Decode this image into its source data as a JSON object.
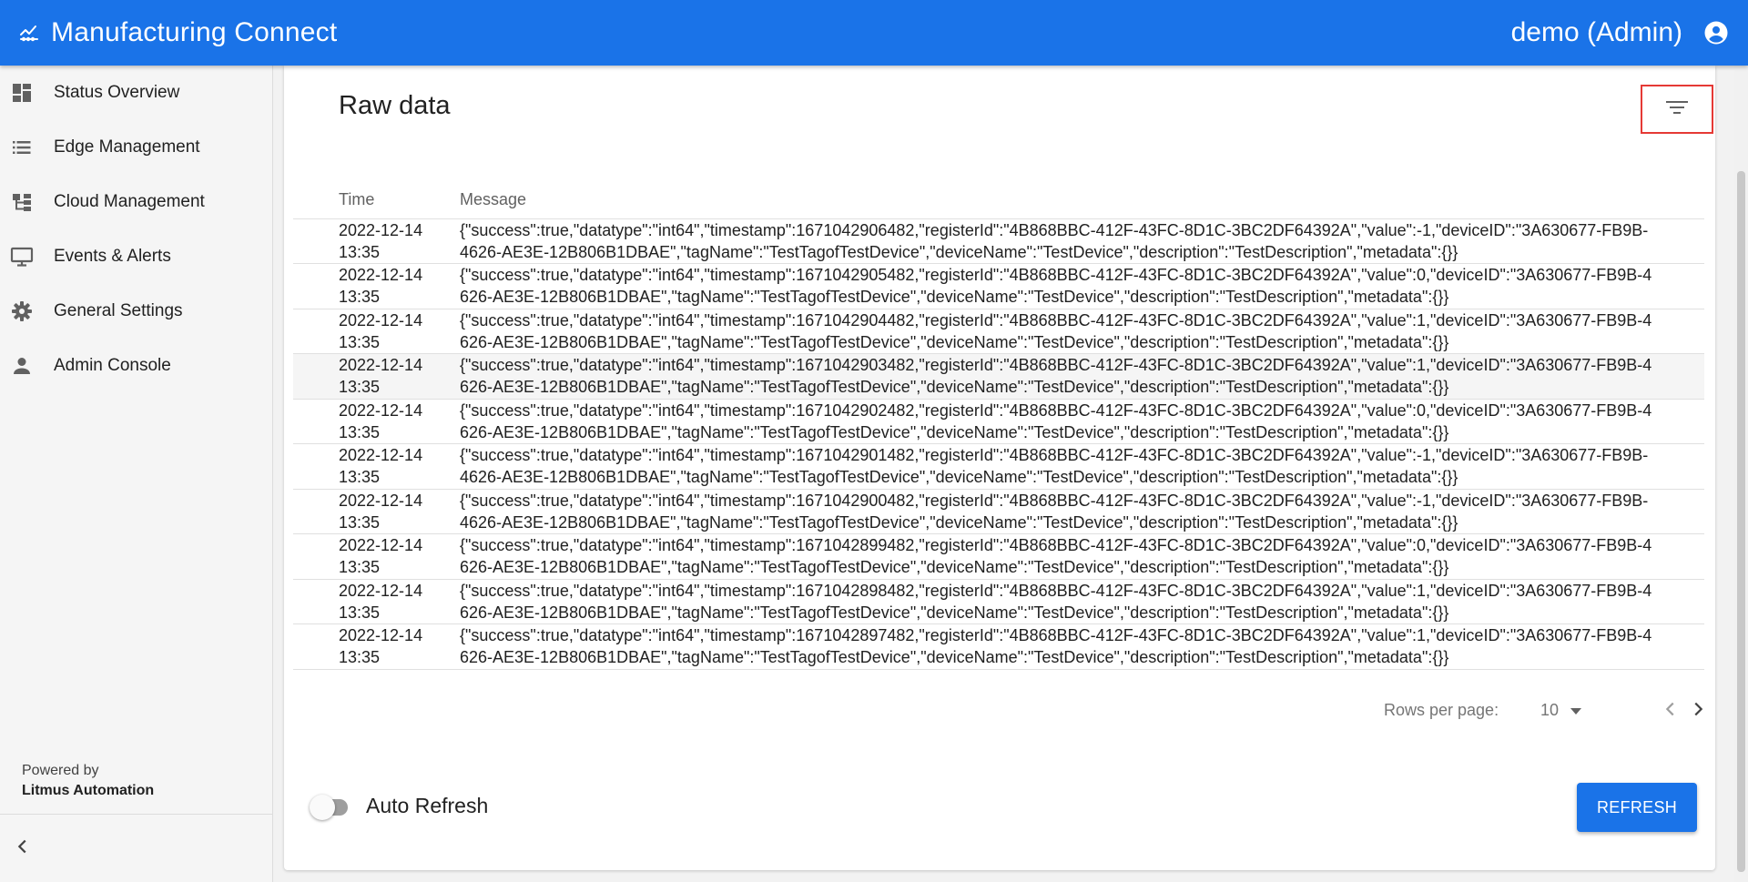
{
  "appbar": {
    "title": "Manufacturing Connect",
    "user": "demo (Admin)",
    "logo_icon": "chart-line-icon",
    "account_icon": "account-circle-icon"
  },
  "sidebar": {
    "items": [
      {
        "label": "Status Overview",
        "icon": "dashboard-icon"
      },
      {
        "label": "Edge Management",
        "icon": "list-icon"
      },
      {
        "label": "Cloud Management",
        "icon": "hierarchy-icon"
      },
      {
        "label": "Events & Alerts",
        "icon": "monitor-icon"
      },
      {
        "label": "General Settings",
        "icon": "gear-icon"
      },
      {
        "label": "Admin Console",
        "icon": "person-icon"
      }
    ],
    "powered_by": "Powered by",
    "brand": "Litmus Automation"
  },
  "main": {
    "title": "Raw data",
    "columns": {
      "time": "Time",
      "message": "Message"
    },
    "rows": [
      {
        "time": "2022-12-14 13:35",
        "message": "{\"success\":true,\"datatype\":\"int64\",\"timestamp\":1671042906482,\"registerId\":\"4B868BBC-412F-43FC-8D1C-3BC2DF64392A\",\"value\":-1,\"deviceID\":\"3A630677-FB9B-4626-AE3E-12B806B1DBAE\",\"tagName\":\"TestTagofTestDevice\",\"deviceName\":\"TestDevice\",\"description\":\"TestDescription\",\"metadata\":{}}"
      },
      {
        "time": "2022-12-14 13:35",
        "message": "{\"success\":true,\"datatype\":\"int64\",\"timestamp\":1671042905482,\"registerId\":\"4B868BBC-412F-43FC-8D1C-3BC2DF64392A\",\"value\":0,\"deviceID\":\"3A630677-FB9B-4626-AE3E-12B806B1DBAE\",\"tagName\":\"TestTagofTestDevice\",\"deviceName\":\"TestDevice\",\"description\":\"TestDescription\",\"metadata\":{}}"
      },
      {
        "time": "2022-12-14 13:35",
        "message": "{\"success\":true,\"datatype\":\"int64\",\"timestamp\":1671042904482,\"registerId\":\"4B868BBC-412F-43FC-8D1C-3BC2DF64392A\",\"value\":1,\"deviceID\":\"3A630677-FB9B-4626-AE3E-12B806B1DBAE\",\"tagName\":\"TestTagofTestDevice\",\"deviceName\":\"TestDevice\",\"description\":\"TestDescription\",\"metadata\":{}}"
      },
      {
        "time": "2022-12-14 13:35",
        "message": "{\"success\":true,\"datatype\":\"int64\",\"timestamp\":1671042903482,\"registerId\":\"4B868BBC-412F-43FC-8D1C-3BC2DF64392A\",\"value\":1,\"deviceID\":\"3A630677-FB9B-4626-AE3E-12B806B1DBAE\",\"tagName\":\"TestTagofTestDevice\",\"deviceName\":\"TestDevice\",\"description\":\"TestDescription\",\"metadata\":{}}"
      },
      {
        "time": "2022-12-14 13:35",
        "message": "{\"success\":true,\"datatype\":\"int64\",\"timestamp\":1671042902482,\"registerId\":\"4B868BBC-412F-43FC-8D1C-3BC2DF64392A\",\"value\":0,\"deviceID\":\"3A630677-FB9B-4626-AE3E-12B806B1DBAE\",\"tagName\":\"TestTagofTestDevice\",\"deviceName\":\"TestDevice\",\"description\":\"TestDescription\",\"metadata\":{}}"
      },
      {
        "time": "2022-12-14 13:35",
        "message": "{\"success\":true,\"datatype\":\"int64\",\"timestamp\":1671042901482,\"registerId\":\"4B868BBC-412F-43FC-8D1C-3BC2DF64392A\",\"value\":-1,\"deviceID\":\"3A630677-FB9B-4626-AE3E-12B806B1DBAE\",\"tagName\":\"TestTagofTestDevice\",\"deviceName\":\"TestDevice\",\"description\":\"TestDescription\",\"metadata\":{}}"
      },
      {
        "time": "2022-12-14 13:35",
        "message": "{\"success\":true,\"datatype\":\"int64\",\"timestamp\":1671042900482,\"registerId\":\"4B868BBC-412F-43FC-8D1C-3BC2DF64392A\",\"value\":-1,\"deviceID\":\"3A630677-FB9B-4626-AE3E-12B806B1DBAE\",\"tagName\":\"TestTagofTestDevice\",\"deviceName\":\"TestDevice\",\"description\":\"TestDescription\",\"metadata\":{}}"
      },
      {
        "time": "2022-12-14 13:35",
        "message": "{\"success\":true,\"datatype\":\"int64\",\"timestamp\":1671042899482,\"registerId\":\"4B868BBC-412F-43FC-8D1C-3BC2DF64392A\",\"value\":0,\"deviceID\":\"3A630677-FB9B-4626-AE3E-12B806B1DBAE\",\"tagName\":\"TestTagofTestDevice\",\"deviceName\":\"TestDevice\",\"description\":\"TestDescription\",\"metadata\":{}}"
      },
      {
        "time": "2022-12-14 13:35",
        "message": "{\"success\":true,\"datatype\":\"int64\",\"timestamp\":1671042898482,\"registerId\":\"4B868BBC-412F-43FC-8D1C-3BC2DF64392A\",\"value\":1,\"deviceID\":\"3A630677-FB9B-4626-AE3E-12B806B1DBAE\",\"tagName\":\"TestTagofTestDevice\",\"deviceName\":\"TestDevice\",\"description\":\"TestDescription\",\"metadata\":{}}"
      },
      {
        "time": "2022-12-14 13:35",
        "message": "{\"success\":true,\"datatype\":\"int64\",\"timestamp\":1671042897482,\"registerId\":\"4B868BBC-412F-43FC-8D1C-3BC2DF64392A\",\"value\":1,\"deviceID\":\"3A630677-FB9B-4626-AE3E-12B806B1DBAE\",\"tagName\":\"TestTagofTestDevice\",\"deviceName\":\"TestDevice\",\"description\":\"TestDescription\",\"metadata\":{}}"
      }
    ],
    "pagination": {
      "rows_per_page_label": "Rows per page:",
      "rows_per_page_value": "10"
    },
    "auto_refresh": {
      "label": "Auto Refresh",
      "enabled": false
    },
    "refresh_label": "REFRESH"
  },
  "colors": {
    "primary": "#1a73e8",
    "highlight_outline": "#e53935"
  }
}
